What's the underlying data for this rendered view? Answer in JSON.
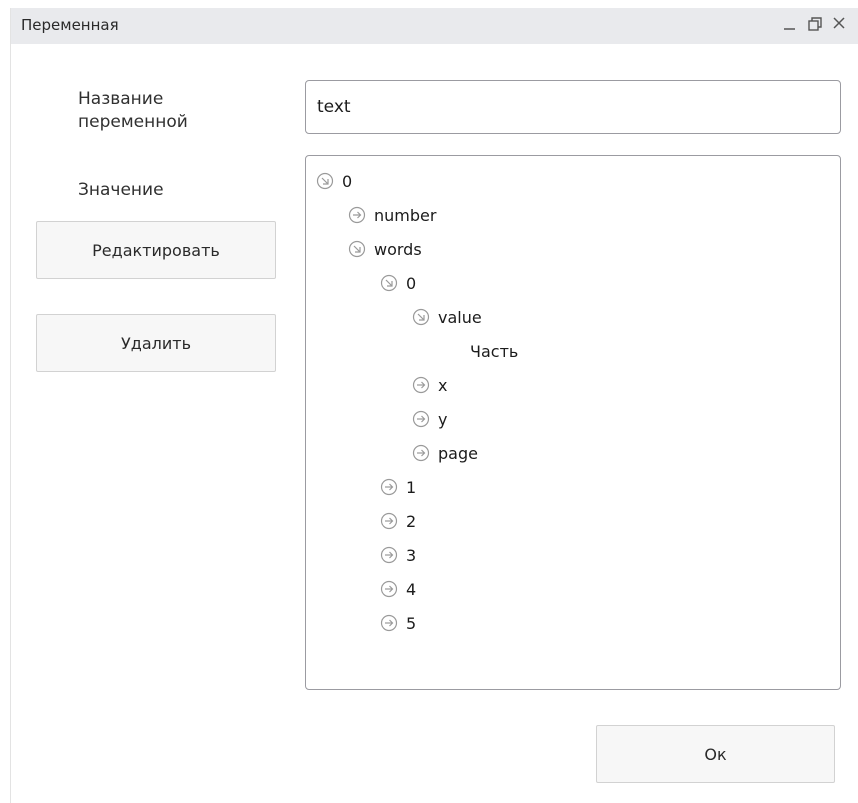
{
  "window": {
    "title": "Переменная"
  },
  "form": {
    "name_label": "Название переменной",
    "name_value": "text",
    "value_label": "Значение",
    "edit_label": "Редактировать",
    "delete_label": "Удалить",
    "ok_label": "Ок"
  },
  "tree": {
    "nodes": [
      {
        "label": "0",
        "state": "expanded"
      },
      {
        "label": "number",
        "state": "collapsed"
      },
      {
        "label": "words",
        "state": "expanded"
      },
      {
        "label": "0",
        "state": "expanded"
      },
      {
        "label": "value",
        "state": "expanded"
      },
      {
        "label": "Часть",
        "state": "leaf"
      },
      {
        "label": "x",
        "state": "collapsed"
      },
      {
        "label": "y",
        "state": "collapsed"
      },
      {
        "label": "page",
        "state": "collapsed"
      },
      {
        "label": "1",
        "state": "collapsed"
      },
      {
        "label": "2",
        "state": "collapsed"
      },
      {
        "label": "3",
        "state": "collapsed"
      },
      {
        "label": "4",
        "state": "collapsed"
      },
      {
        "label": "5",
        "state": "collapsed"
      }
    ]
  },
  "icons": {
    "expanded": "expanded-arrow-icon",
    "collapsed": "collapsed-arrow-icon",
    "minimize": "minimize-icon",
    "restore": "restore-icon",
    "close": "close-icon"
  },
  "colors": {
    "titlebar": "#e9eaed",
    "border": "#9b9ba1",
    "button": "#f7f7f7",
    "icon": "#9a9a9a"
  }
}
